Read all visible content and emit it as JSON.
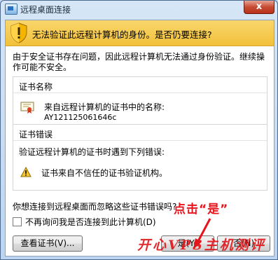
{
  "window": {
    "title": "远程桌面连接",
    "close_label": "x"
  },
  "banner": {
    "text": "无法验证此远程计算机的身份。是否仍要连接?",
    "icon": "shield-warning-icon"
  },
  "description": "由于安全证书存在问题，因此远程计算机无法通过身份验证。继续操作可能不安全。",
  "cert_group": {
    "title": "证书名称",
    "line1": "来自远程计算机的证书中的名称:",
    "line2": "AY121125061646c",
    "icon": "certificate-icon"
  },
  "error_group": {
    "title": "证书错误",
    "line1": "验证远程计算机的证书时遇到下列错误:",
    "line2": "证书来自不信任的证书验证机构。",
    "icon": "warning-icon"
  },
  "question": "你想连接到远程桌面而忽略这些证书错误吗?",
  "checkbox": {
    "label": "不再询问我是否连接到此计算机(D)",
    "checked": false
  },
  "buttons": {
    "view_cert": "查看证书(V)...",
    "yes": "是(Y)",
    "no": "否(N)"
  },
  "annotation": {
    "text": "点击“是”",
    "color": "#e8141c"
  },
  "watermark": "开心VPS主机测评",
  "colors": {
    "banner": "#f2c13a",
    "accent_red": "#e0181c",
    "titlebar": "#c7dcf3"
  }
}
